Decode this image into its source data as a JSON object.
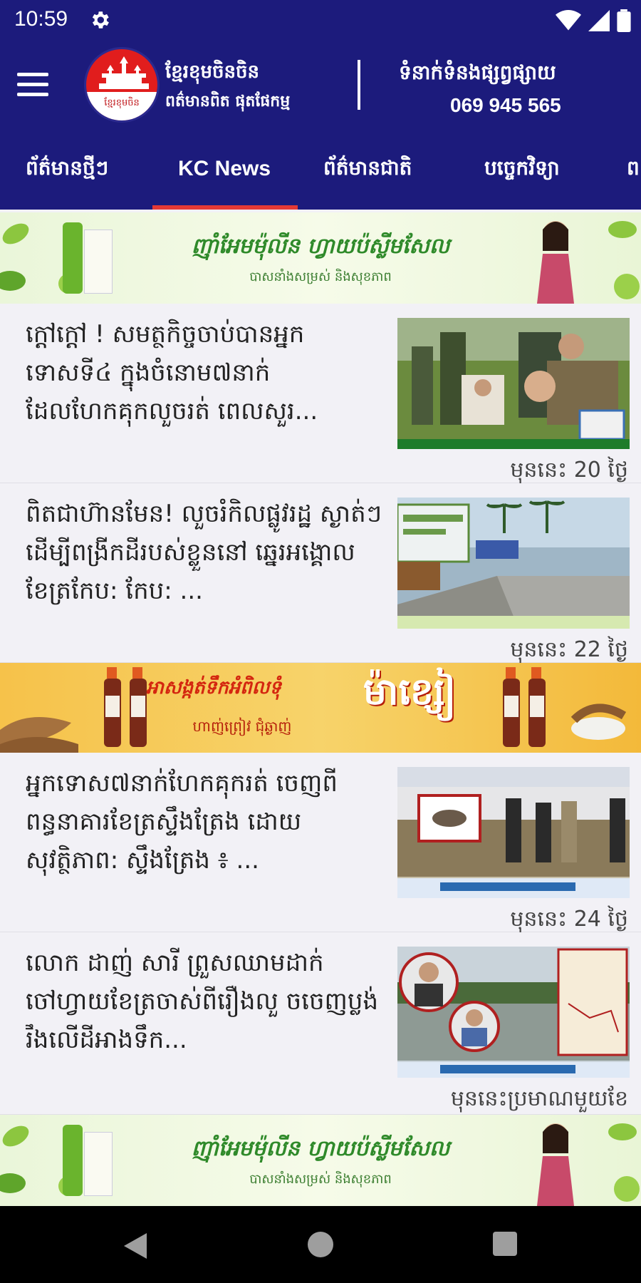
{
  "status_bar": {
    "time": "10:59"
  },
  "header": {
    "brand_name": "ខ្មែរខុមចិនចិន",
    "brand_sub": "ពត៌មានពិត ផុតផែកម្ម",
    "logo_caption": "ខ្មែរខុមចិន",
    "contact_label": "ទំនាក់ទំនងផ្សព្វផ្សាយ",
    "contact_phone": "069 945 565"
  },
  "tabs": [
    {
      "label": "ព័ត៌មានថ្មីៗ",
      "active": false
    },
    {
      "label": "KC News",
      "active": true
    },
    {
      "label": "ព័ត៌មានជាតិ",
      "active": false
    },
    {
      "label": "បច្ចេកវិទ្យា",
      "active": false
    },
    {
      "label": "ព",
      "active": false
    }
  ],
  "banners": {
    "green": {
      "title": "ញ៉ាំអែមម៉ុលីន ហ្វាយប៉ស្លីមសែល",
      "sub": "បាសនាំងសម្រស់ និងសុខភាព"
    },
    "orange": {
      "title": "អាសង្កត់ទឹកអំពិលទុំ",
      "big": "ម៉ាខ្សៀ",
      "sub": "ហាញ់ព្រៀវ ជុំឆ្ងាញ់"
    }
  },
  "articles": [
    {
      "title": "ក្តៅក្តៅ ! សមត្ថកិច្ចចាប់បានអ្នកទោសទី៤ ក្នុងចំនោម៧នាក់ ដែលហែកគុកលួចរត់ ពេលសួរ...",
      "time": "មុននេះ 20 ថ្ងៃ"
    },
    {
      "title": "ពិតជាហ៊ានមែន! លួចរំកិលផ្លូវរដ្ឋ ស្ងាត់ៗដើម្បីពង្រីកដីរបស់ខ្លួននៅ ឆ្នេរអង្គោល ខែត្រកែប: កែប: ...",
      "time": "មុននេះ 22 ថ្ងៃ"
    },
    {
      "title": "អ្នកទោស៧នាក់ហែកគុករត់ ចេញពីពន្ធនាគារខែត្រស្ទឹងត្រែង ដោយសុវត្ថិភាព: ស្ទឹងត្រែង ៖ ...",
      "time": "មុននេះ 24 ថ្ងៃ"
    },
    {
      "title": "លោក ដាញ់ សារី ព្រួសឈាមដាក់ ចៅហ្វាយខែត្រចាស់ពីរឿងលួ ចចេញប្លង់រឹងលើដីអាងទឹក...",
      "time": "មុននេះប្រមាណមួយខែ"
    }
  ]
}
